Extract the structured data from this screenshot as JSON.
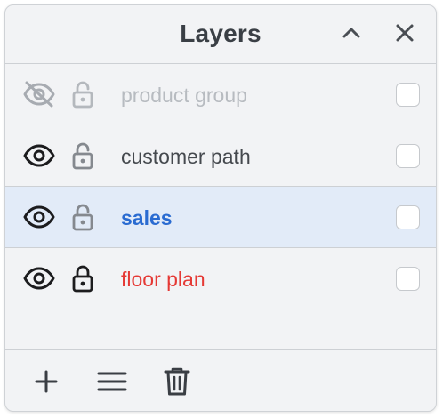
{
  "panel": {
    "title": "Layers",
    "collapse_icon": "chevron-up-icon",
    "close_icon": "close-icon"
  },
  "layers": [
    {
      "name": "product group",
      "visible": false,
      "locked": false,
      "selected": false,
      "checked": false,
      "name_color": "#b7bbc0",
      "name_weight": "normal",
      "eye_color": "#a7abb1",
      "lock_color": "#b4b8bd"
    },
    {
      "name": "customer path",
      "visible": true,
      "locked": false,
      "selected": false,
      "checked": false,
      "name_color": "#45494e",
      "name_weight": "normal",
      "eye_color": "#1c1c1e",
      "lock_color": "#85898f"
    },
    {
      "name": "sales",
      "visible": true,
      "locked": false,
      "selected": true,
      "checked": false,
      "name_color": "#2a6bd1",
      "name_weight": "bold",
      "eye_color": "#1c1c1e",
      "lock_color": "#85898f"
    },
    {
      "name": "floor plan",
      "visible": true,
      "locked": true,
      "selected": false,
      "checked": false,
      "name_color": "#e53935",
      "name_weight": "normal",
      "eye_color": "#1c1c1e",
      "lock_color": "#1c1c1e"
    }
  ],
  "footer": {
    "add_icon": "plus-icon",
    "menu_icon": "menu-icon",
    "delete_icon": "trash-icon"
  },
  "colors": {
    "panel_bg": "#f2f3f5",
    "selected_row_bg": "#e2ebf8",
    "divider": "#cdd0d4",
    "title": "#3a3f45"
  }
}
